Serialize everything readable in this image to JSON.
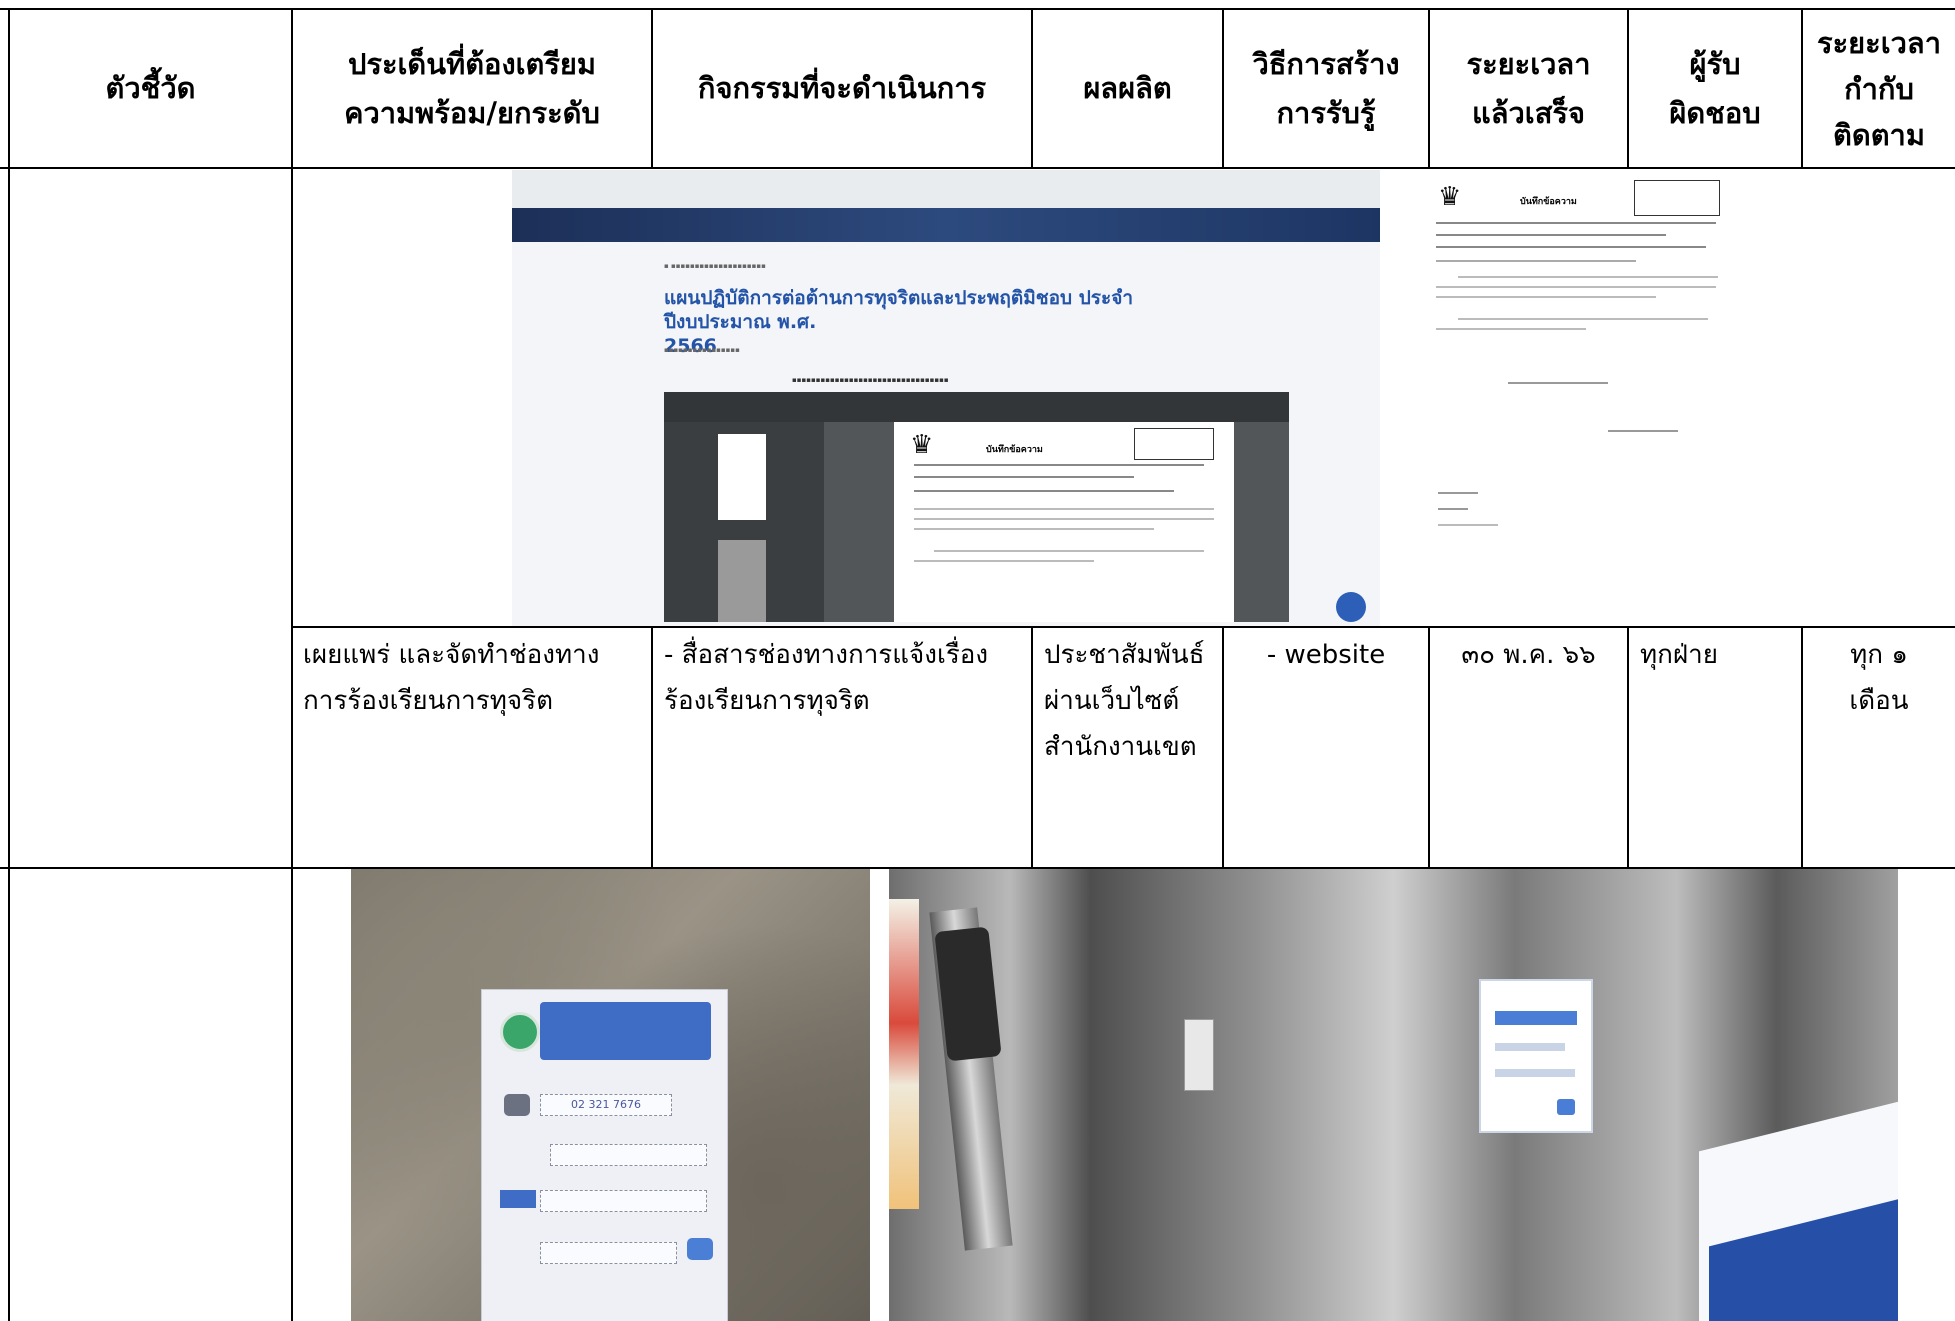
{
  "headers": {
    "indicator": "ตัวชี้วัด",
    "issue": [
      "ประเด็นที่ต้องเตรียม",
      "ความพร้อม/ยกระดับ"
    ],
    "activity": "กิจกรรมที่จะดำเนินการ",
    "output": "ผลผลิต",
    "awareness": [
      "วิธีการสร้าง",
      "การรับรู้"
    ],
    "completion": [
      "ระยะเวลา",
      "แล้วเสร็จ"
    ],
    "owner": [
      "ผู้รับ",
      "ผิดชอบ"
    ],
    "monitoring": [
      "ระยะเวลา",
      "กำกับ",
      "ติดตาม"
    ]
  },
  "screenshot": {
    "page_title": [
      "แผนปฏิบัติการต่อต้านการทุจริตและประพฤติมิชอบ ประจำปีงบประมาณ พ.ศ.",
      "2566"
    ],
    "memo_heading": "บันทึกข้อความ",
    "seal_symbol": "♛"
  },
  "row": {
    "issue": [
      "เผยแพร่ และจัดทำช่องทาง",
      "การร้องเรียนการทุจริต"
    ],
    "activity": [
      "- สื่อสารช่องทางการแจ้งเรื่อง",
      "ร้องเรียนการทุจริต"
    ],
    "output": [
      "ประชาสัมพันธ์",
      "ผ่านเว็บไซต์",
      "สำนักงานเขต"
    ],
    "awareness": "- website",
    "completion": "๓๐ พ.ค. ๖๖",
    "owner": "ทุกฝ่าย",
    "monitoring": [
      "ทุก ๑",
      "เดือน"
    ]
  },
  "photos": {
    "poster_phone": "02 321 7676"
  },
  "colors": {
    "border": "#000000",
    "title_blue": "#2454a8"
  }
}
